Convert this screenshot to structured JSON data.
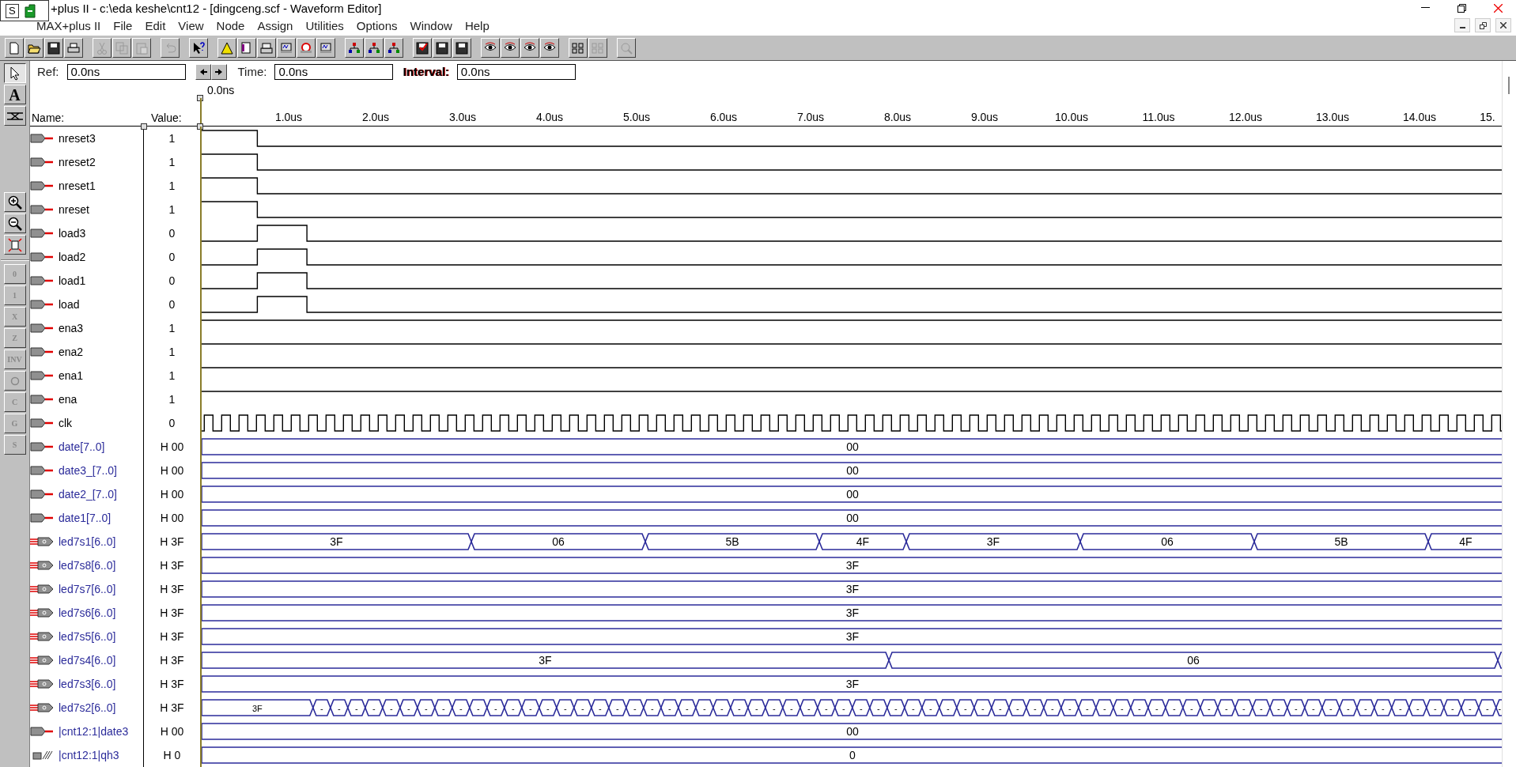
{
  "window": {
    "title": "+plus II - c:\\eda  keshe\\cnt12 - [dingceng.scf - Waveform Editor]",
    "badge": "S"
  },
  "menu": [
    "MAX+plus II",
    "File",
    "Edit",
    "View",
    "Node",
    "Assign",
    "Utilities",
    "Options",
    "Window",
    "Help"
  ],
  "toolbar": [
    {
      "disabled": false
    },
    {
      "disabled": false
    },
    {
      "disabled": false
    },
    {
      "disabled": false
    },
    {
      "disabled": true
    },
    {
      "disabled": true
    },
    {
      "disabled": true
    },
    {
      "disabled": true
    },
    {
      "disabled": false
    },
    {
      "disabled": false
    },
    {
      "disabled": false
    },
    {
      "disabled": false
    },
    {
      "disabled": false
    },
    {
      "disabled": false
    },
    {
      "disabled": false
    },
    {
      "disabled": false
    },
    {
      "disabled": false
    },
    {
      "disabled": false
    },
    {
      "disabled": false
    },
    {
      "disabled": false
    },
    {
      "disabled": false
    },
    {
      "disabled": false
    },
    {
      "disabled": false
    },
    {
      "disabled": false
    },
    {
      "disabled": false
    },
    {
      "disabled": false
    },
    {
      "disabled": true
    },
    {
      "disabled": true
    }
  ],
  "edit_tools": [
    {
      "selected": true
    },
    {
      "selected": false,
      "label": "A"
    },
    {
      "selected": false
    }
  ],
  "value_tools": [
    {
      "label": "0",
      "disabled": true
    },
    {
      "label": "1",
      "disabled": true
    },
    {
      "label": "X",
      "disabled": true
    },
    {
      "label": "Z",
      "disabled": true
    },
    {
      "label": "INV",
      "disabled": true
    },
    {
      "disabled": true
    },
    {
      "label": "C",
      "disabled": true
    },
    {
      "label": "G",
      "disabled": true
    },
    {
      "label": "S",
      "disabled": true
    }
  ],
  "fields": {
    "ref_label": "Ref:",
    "ref": "0.0ns",
    "time_label": "Time:",
    "time": "0.0ns",
    "interval_label": "Interval:",
    "interval": "0.0ns"
  },
  "cursor": "0.0ns",
  "headers": {
    "name": "Name:",
    "value": "Value:"
  },
  "ruler": [
    "1.0us",
    "2.0us",
    "3.0us",
    "4.0us",
    "5.0us",
    "6.0us",
    "7.0us",
    "8.0us",
    "9.0us",
    "10.0us",
    "11.0us",
    "12.0us",
    "13.0us",
    "14.0us",
    "15."
  ],
  "signals": [
    {
      "name": "nreset3",
      "value": "1",
      "pin": {
        "kind": "input"
      },
      "wave": {
        "kind": "fall"
      }
    },
    {
      "name": "nreset2",
      "value": "1",
      "pin": {
        "kind": "input"
      },
      "wave": {
        "kind": "fall"
      }
    },
    {
      "name": "nreset1",
      "value": "1",
      "pin": {
        "kind": "input"
      },
      "wave": {
        "kind": "fall"
      }
    },
    {
      "name": "nreset",
      "value": "1",
      "pin": {
        "kind": "input"
      },
      "wave": {
        "kind": "fall"
      }
    },
    {
      "name": "load3",
      "value": "0",
      "pin": {
        "kind": "input"
      },
      "wave": {
        "kind": "pulse"
      }
    },
    {
      "name": "load2",
      "value": "0",
      "pin": {
        "kind": "input"
      },
      "wave": {
        "kind": "pulse"
      }
    },
    {
      "name": "load1",
      "value": "0",
      "pin": {
        "kind": "input"
      },
      "wave": {
        "kind": "pulse"
      }
    },
    {
      "name": "load",
      "value": "0",
      "pin": {
        "kind": "input"
      },
      "wave": {
        "kind": "pulse"
      }
    },
    {
      "name": "ena3",
      "value": "1",
      "pin": {
        "kind": "input"
      },
      "wave": {
        "kind": "high"
      }
    },
    {
      "name": "ena2",
      "value": "1",
      "pin": {
        "kind": "input"
      },
      "wave": {
        "kind": "high"
      }
    },
    {
      "name": "ena1",
      "value": "1",
      "pin": {
        "kind": "input"
      },
      "wave": {
        "kind": "high"
      }
    },
    {
      "name": "ena",
      "value": "1",
      "pin": {
        "kind": "input"
      },
      "wave": {
        "kind": "high"
      }
    },
    {
      "name": "clk",
      "value": "0",
      "pin": {
        "kind": "input"
      },
      "wave": {
        "kind": "clock"
      }
    },
    {
      "name": "date[7..0]",
      "value": "H 00",
      "pin": {
        "kind": "input"
      },
      "wave": {
        "kind": "bus_steady"
      },
      "segments": [
        "00"
      ]
    },
    {
      "name": "date3_[7..0]",
      "value": "H 00",
      "pin": {
        "kind": "input"
      },
      "wave": {
        "kind": "bus_steady"
      },
      "segments": [
        "00"
      ]
    },
    {
      "name": "date2_[7..0]",
      "value": "H 00",
      "pin": {
        "kind": "input"
      },
      "wave": {
        "kind": "bus_steady"
      },
      "segments": [
        "00"
      ]
    },
    {
      "name": "date1[7..0]",
      "value": "H 00",
      "pin": {
        "kind": "input"
      },
      "wave": {
        "kind": "bus_steady"
      },
      "segments": [
        "00"
      ]
    },
    {
      "name": "led7s1[6..0]",
      "value": "H 3F",
      "pin": {
        "kind": "output"
      },
      "wave": {
        "kind": "bus_digits"
      },
      "segments": [
        "3F",
        "06",
        "5B",
        "4F",
        "3F",
        "06",
        "5B",
        "4F"
      ]
    },
    {
      "name": "led7s8[6..0]",
      "value": "H 3F",
      "pin": {
        "kind": "output"
      },
      "wave": {
        "kind": "bus_steady"
      },
      "segments": [
        "3F"
      ]
    },
    {
      "name": "led7s7[6..0]",
      "value": "H 3F",
      "pin": {
        "kind": "output"
      },
      "wave": {
        "kind": "bus_steady"
      },
      "segments": [
        "3F"
      ]
    },
    {
      "name": "led7s6[6..0]",
      "value": "H 3F",
      "pin": {
        "kind": "output"
      },
      "wave": {
        "kind": "bus_steady"
      },
      "segments": [
        "3F"
      ]
    },
    {
      "name": "led7s5[6..0]",
      "value": "H 3F",
      "pin": {
        "kind": "output"
      },
      "wave": {
        "kind": "bus_steady"
      },
      "segments": [
        "3F"
      ]
    },
    {
      "name": "led7s4[6..0]",
      "value": "H 3F",
      "pin": {
        "kind": "output"
      },
      "wave": {
        "kind": "bus_split"
      },
      "segments": [
        "3F",
        "06"
      ]
    },
    {
      "name": "led7s3[6..0]",
      "value": "H 3F",
      "pin": {
        "kind": "output"
      },
      "wave": {
        "kind": "bus_steady"
      },
      "segments": [
        "3F"
      ]
    },
    {
      "name": "led7s2[6..0]",
      "value": "H 3F",
      "pin": {
        "kind": "output"
      },
      "wave": {
        "kind": "bus_toggle"
      },
      "segments": [
        "3F",
        "-",
        "-",
        "-",
        "-",
        "-",
        "-",
        "-",
        "-",
        "-",
        "-",
        "-",
        "-",
        "-",
        "-",
        "-",
        "-",
        "-",
        "-",
        "-",
        "-",
        "-",
        "-",
        "-",
        "-",
        "-",
        "-",
        "-",
        "-",
        "-",
        "-",
        "-",
        "-",
        "-",
        "-",
        "-",
        "-",
        "-",
        "-",
        "-",
        "-",
        "-",
        "-",
        "-",
        "-",
        "-",
        "-",
        "-",
        "-",
        "-",
        "-",
        "-",
        "-",
        "-",
        "-",
        "-",
        "-",
        "-",
        "-",
        "-",
        "-",
        "-",
        "-",
        "-",
        "-",
        "-",
        "-",
        "-",
        "-",
        "-"
      ]
    },
    {
      "name": "|cnt12:1|date3",
      "value": "H 00",
      "pin": {
        "kind": "input"
      },
      "wave": {
        "kind": "bus_steady"
      },
      "segments": [
        "00"
      ]
    },
    {
      "name": "|cnt12:1|qh3",
      "value": "H 0",
      "pin": {
        "kind": "buried"
      },
      "wave": {
        "kind": "bus_steady"
      },
      "segments": [
        "0"
      ]
    }
  ]
}
